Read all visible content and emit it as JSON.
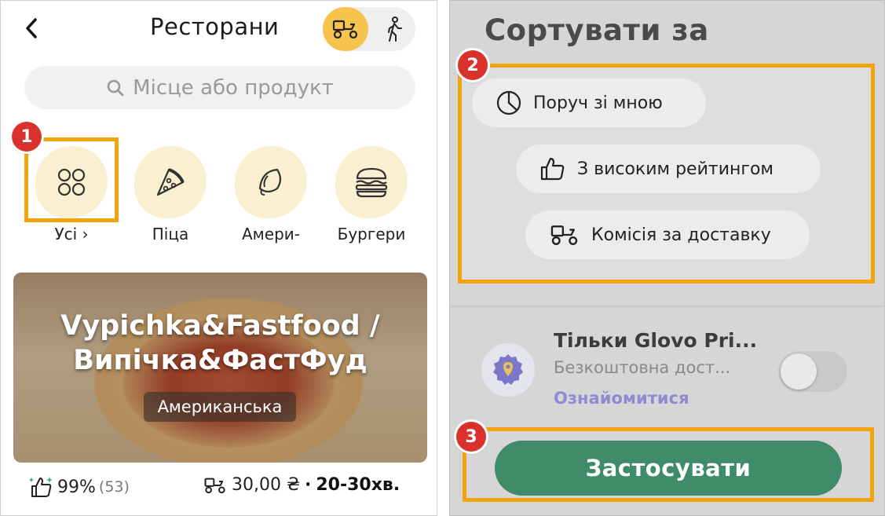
{
  "left": {
    "title": "Ресторани",
    "mode_icons": [
      "delivery-scooter-icon",
      "walking-pickup-icon"
    ],
    "search": {
      "placeholder": "Місце або продукт"
    },
    "categories": [
      {
        "label": "Усі ›",
        "icon": "all-categories-icon"
      },
      {
        "label": "Піца",
        "icon": "pizza-icon"
      },
      {
        "label": "Амери-",
        "icon": "taco-icon"
      },
      {
        "label": "Бургери",
        "icon": "burger-icon"
      }
    ],
    "badges": {
      "one": "1",
      "two": "2",
      "three": "3"
    },
    "restaurant": {
      "name_line1": "Vypichka&Fastfood /",
      "name_line2": "Випічка&ФастФуд",
      "cuisine": "Американська",
      "rating": "99%",
      "reviews": "(53)",
      "delivery_fee": "30,00 ₴",
      "separator": "·",
      "eta": "20-30хв."
    }
  },
  "right": {
    "title": "Сортувати за",
    "sort_options": [
      {
        "label": "Поруч зі мною",
        "icon": "clock-icon"
      },
      {
        "label": "З високим рейтингом",
        "icon": "thumbs-up-icon"
      },
      {
        "label": "Комісія за доставку",
        "icon": "delivery-scooter-icon"
      }
    ],
    "prime": {
      "title": "Тільки Glovo Pri...",
      "subtitle": "Безкоштовна дост...",
      "link": "Ознайомитися",
      "enabled": false
    },
    "apply_label": "Застосувати"
  },
  "colors": {
    "accent_yellow": "#f6c34d",
    "highlight_orange": "#f2a40d",
    "badge_red": "#d9322c",
    "apply_green": "#3f8b6a",
    "link_purple": "#8f8bd3"
  }
}
